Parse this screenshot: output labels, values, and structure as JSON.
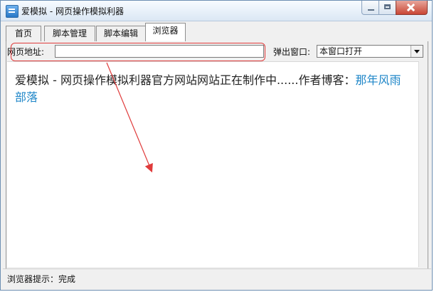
{
  "window": {
    "title": "爱模拟 - 网页操作模拟利器"
  },
  "tabs": [
    {
      "label": "首页",
      "active": false
    },
    {
      "label": "脚本管理",
      "active": false
    },
    {
      "label": "脚本编辑",
      "active": false
    },
    {
      "label": "浏览器",
      "active": true
    }
  ],
  "toolbar": {
    "url_label": "网页地址:",
    "url_value": "",
    "popup_label": "弹出窗口:",
    "popup_value": "本窗口打开"
  },
  "page": {
    "text": "爱模拟 - 网页操作模拟利器官方网站网站正在制作中......作者博客：",
    "link_text": "那年风雨部落"
  },
  "status": {
    "text": "浏览器提示：完成"
  },
  "colors": {
    "annotation": "#e03b3b",
    "link": "#1e86c8"
  },
  "icons": {
    "app": "app-icon",
    "minimize": "minimize-icon",
    "maximize": "maximize-icon",
    "close": "close-icon",
    "dropdown": "chevron-down-icon"
  }
}
